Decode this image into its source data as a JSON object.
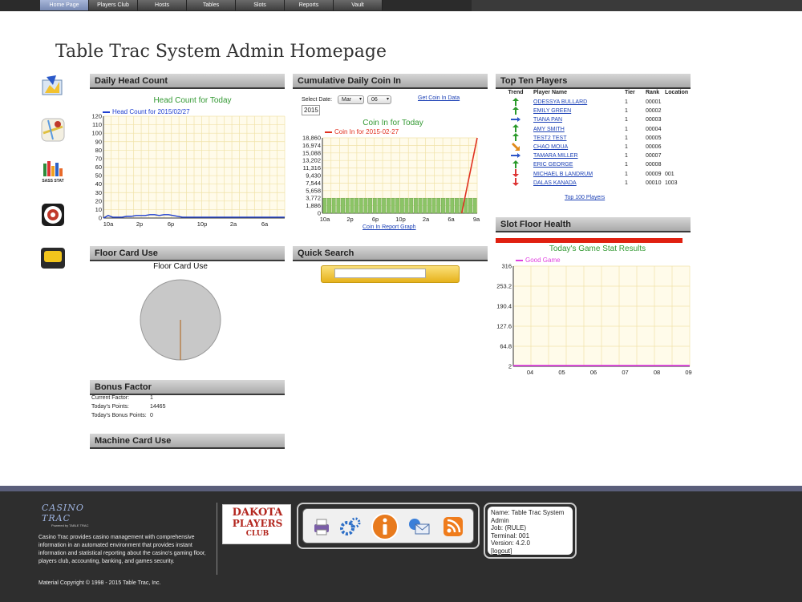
{
  "nav": [
    "Home Page",
    "Players Club",
    "Hosts",
    "Tables",
    "Slots",
    "Reports",
    "Vault"
  ],
  "page_title": "Table Trac System Admin Homepage",
  "side_icons": [
    "dashboard-icon",
    "map-icon",
    "sass-stat-icon",
    "players-club-icon",
    "tv-icon"
  ],
  "sass_stat_label": "SASS STAT",
  "head_count": {
    "header": "Daily Head Count",
    "chart_data": {
      "type": "line",
      "title": "Head Count for Today",
      "series": [
        {
          "name": "Head Count for 2015/02/27",
          "color": "#1f3fd0",
          "values": [
            0,
            3,
            1,
            1,
            1,
            2,
            2,
            3,
            3,
            3,
            4,
            4,
            3,
            4,
            4,
            3,
            2,
            1,
            1,
            1,
            1,
            1,
            1,
            1,
            1,
            1,
            1,
            1,
            1,
            1,
            1,
            1,
            1,
            1,
            1,
            1,
            1,
            1,
            1,
            1
          ]
        }
      ],
      "x_ticks": [
        "10a",
        "2p",
        "6p",
        "10p",
        "2a",
        "6a"
      ],
      "y_ticks": [
        0,
        10,
        20,
        30,
        40,
        50,
        60,
        70,
        80,
        90,
        100,
        110,
        120
      ],
      "ylim": [
        0,
        120
      ]
    }
  },
  "coin_in": {
    "header": "Cumulative Daily Coin In",
    "select_label": "Select Date:",
    "month": "Mar",
    "day": "06",
    "year": "2015",
    "get_link": "Get Coin In Data",
    "report_link": "Coin In Report Graph",
    "chart_data": {
      "type": "bar",
      "title": "Coin In for Today",
      "series": [
        {
          "name": "Coin In for 2015-02-27",
          "color": "#e03020"
        }
      ],
      "bar_value": 3772,
      "bar_count": 34,
      "line_points": [
        [
          0.9,
          0
        ],
        [
          1.0,
          18860
        ]
      ],
      "x_ticks": [
        "10a",
        "2p",
        "6p",
        "10p",
        "2a",
        "6a",
        "9a"
      ],
      "y_ticks": [
        "0",
        "1,886",
        "3,772",
        "5,658",
        "7,544",
        "9,430",
        "11,316",
        "13,202",
        "15,088",
        "16,974",
        "18,860"
      ],
      "ylim": [
        0,
        18860
      ]
    }
  },
  "top_ten": {
    "header": "Top Ten Players",
    "columns": [
      "Trend",
      "Player Name",
      "Tier",
      "Rank",
      "Location"
    ],
    "rows": [
      {
        "trend": "up",
        "name": "ODESSYA BULLARD",
        "tier": "1",
        "rank": "00001",
        "loc": ""
      },
      {
        "trend": "up",
        "name": "EMILY GREEN",
        "tier": "1",
        "rank": "00002",
        "loc": ""
      },
      {
        "trend": "right",
        "name": "TIANA PAN",
        "tier": "1",
        "rank": "00003",
        "loc": ""
      },
      {
        "trend": "up",
        "name": "AMY SMITH",
        "tier": "1",
        "rank": "00004",
        "loc": ""
      },
      {
        "trend": "up",
        "name": "TEST2 TEST",
        "tier": "1",
        "rank": "00005",
        "loc": ""
      },
      {
        "trend": "down-right",
        "name": "CHAO MOUA",
        "tier": "1",
        "rank": "00006",
        "loc": ""
      },
      {
        "trend": "right",
        "name": "TAMARA MILLER",
        "tier": "1",
        "rank": "00007",
        "loc": ""
      },
      {
        "trend": "up",
        "name": "ERIC GEORGE",
        "tier": "1",
        "rank": "00008",
        "loc": ""
      },
      {
        "trend": "down",
        "name": "MICHAEL B LANDRUM",
        "tier": "1",
        "rank": "00009",
        "loc": "001"
      },
      {
        "trend": "down",
        "name": "DALAS KANADA",
        "tier": "1",
        "rank": "00010",
        "loc": "1003"
      }
    ],
    "more_link": "Top 100 Players"
  },
  "slot_health": {
    "header": "Slot Floor Health",
    "chart_data": {
      "type": "line",
      "title": "Today's Game Stat Results",
      "series": [
        {
          "name": "Good Game",
          "color": "#e040e0",
          "values": [
            2,
            2,
            2,
            2,
            2,
            2
          ]
        }
      ],
      "x_ticks": [
        "04",
        "05",
        "06",
        "07",
        "08",
        "09"
      ],
      "y_ticks": [
        "2",
        "64.8",
        "127.6",
        "190.4",
        "253.2",
        "316"
      ],
      "ylim": [
        2,
        316
      ]
    }
  },
  "floor_card": {
    "header": "Floor Card Use",
    "chart_data": {
      "type": "pie",
      "title": "Floor Card Use",
      "values": [
        100
      ]
    }
  },
  "quick_search": {
    "header": "Quick Search",
    "value": ""
  },
  "bonus": {
    "header": "Bonus Factor",
    "rows": [
      {
        "k": "Current Factor:",
        "v": "1"
      },
      {
        "k": "Today's Points:",
        "v": "14465"
      },
      {
        "k": "Today's Bonus Points:",
        "v": "0"
      }
    ]
  },
  "machine_card": {
    "header": "Machine Card Use"
  },
  "footer": {
    "logo": "CASINO TRAC",
    "logo_sub": "Powered by TABLE TRAC",
    "desc": "Casino Trac provides casino management with comprehensive information in an automated environment that provides instant information and statistical reporting about the casino's gaming floor, players club, accounting, banking, and games security.",
    "copyright": "Material Copyright © 1998 - 2015 Table Trac, Inc.",
    "dakota_top": "DAKOTA",
    "dakota_mid": "PLAYERS",
    "dakota_bot": "CLUB",
    "toolbar_icons": [
      "printer-icon",
      "gears-icon",
      "info-icon",
      "email-icon",
      "rss-icon"
    ],
    "user": {
      "name": "Name: Table Trac System Admin",
      "job": "Job: (RULE)",
      "terminal": "Terminal: 001",
      "version": "Version: 4.2.0",
      "logout": "[logout]"
    }
  }
}
